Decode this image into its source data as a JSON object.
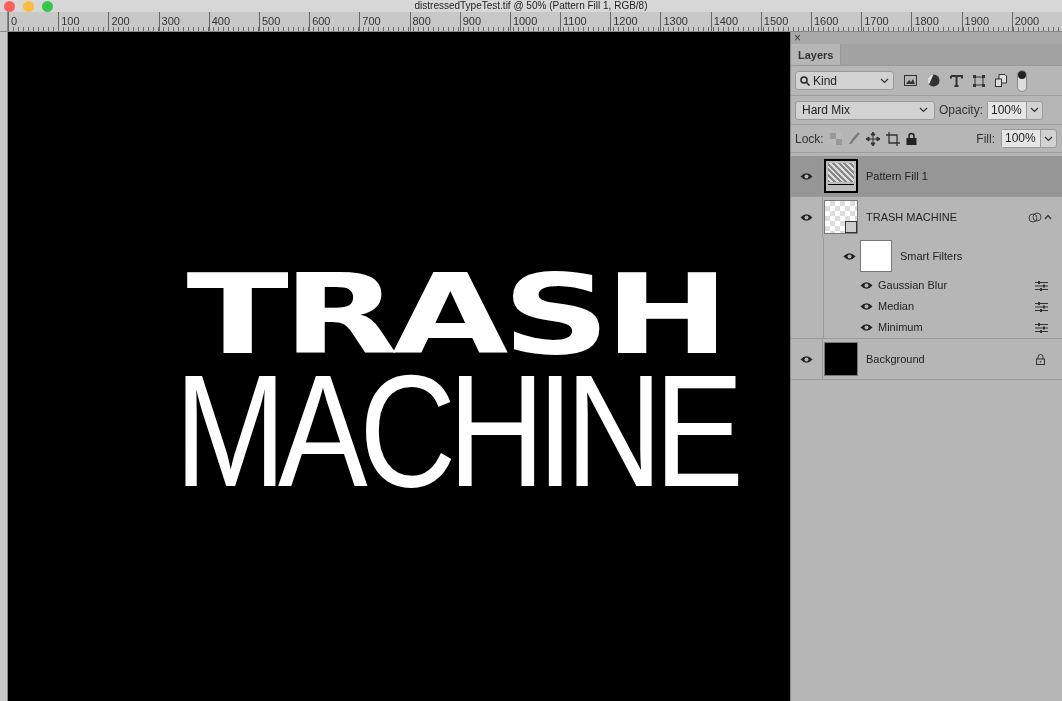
{
  "window": {
    "title": "distressedTypeTest.tif @ 50% (Pattern Fill 1, RGB/8)"
  },
  "ruler": {
    "labels": [
      "0",
      "100",
      "200",
      "300",
      "400",
      "500",
      "600",
      "700",
      "800",
      "900",
      "1000",
      "1100",
      "1200",
      "1300",
      "1400",
      "1500",
      "1600",
      "1700",
      "1800",
      "1900",
      "2000"
    ]
  },
  "canvas": {
    "lines": [
      {
        "text": "TRASH",
        "kind": "heavy"
      },
      {
        "text": "MACHINE",
        "kind": "thin"
      }
    ]
  },
  "panel": {
    "close": "×",
    "tabs": [
      {
        "label": "Layers",
        "selected": true
      }
    ],
    "filter": {
      "value": "Kind"
    },
    "blend_mode": {
      "value": "Hard Mix"
    },
    "opacity": {
      "label": "Opacity:",
      "value": "100%"
    },
    "lock": {
      "label": "Lock:"
    },
    "fill": {
      "label": "Fill:",
      "value": "100%"
    },
    "layers": [
      {
        "name": "Pattern Fill 1",
        "kind": "pattern",
        "visible": true,
        "selected": true,
        "locked": false
      },
      {
        "name": "TRASH MACHINE",
        "kind": "smart",
        "visible": true,
        "selected": false,
        "locked": false,
        "expanded": true,
        "children": [
          {
            "name": "Smart Filters",
            "kind": "filters",
            "visible": true,
            "selected": false,
            "children": [
              {
                "name": "Gaussian Blur",
                "kind": "filter",
                "visible": true,
                "selected": false
              },
              {
                "name": "Median",
                "kind": "filter",
                "visible": true,
                "selected": false
              },
              {
                "name": "Minimum",
                "kind": "filter",
                "visible": true,
                "selected": false
              }
            ]
          }
        ]
      },
      {
        "name": "Background",
        "kind": "background",
        "visible": true,
        "selected": false,
        "locked": true
      }
    ]
  }
}
